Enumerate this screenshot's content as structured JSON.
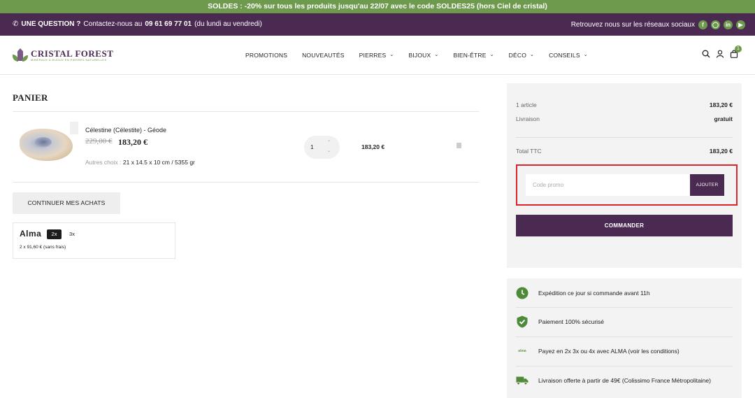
{
  "promo_bar": {
    "text": "SOLDES : -20% sur tous les produits jusqu'au 22/07 avec le code SOLDES25 (hors Ciel de cristal)"
  },
  "contact_bar": {
    "question_label": "UNE QUESTION ?",
    "contact_text": "Contactez-nous au",
    "phone": "09 61 69 77 01",
    "hours": "(du lundi au vendredi)",
    "social_text": "Retrouvez nous sur les réseaux sociaux",
    "socials": [
      "facebook-icon",
      "instagram-icon",
      "linkedin-icon",
      "youtube-icon"
    ]
  },
  "header": {
    "logo_name": "CRISTAL FOREST",
    "logo_tagline": "MINÉRAUX & BIJOUX EN PIERRES NATURELLES",
    "nav": [
      {
        "label": "PROMOTIONS",
        "dropdown": false
      },
      {
        "label": "NOUVEAUTÉS",
        "dropdown": false
      },
      {
        "label": "PIERRES",
        "dropdown": true
      },
      {
        "label": "BIJOUX",
        "dropdown": true
      },
      {
        "label": "BIEN-ÊTRE",
        "dropdown": true
      },
      {
        "label": "DÉCO",
        "dropdown": true
      },
      {
        "label": "CONSEILS",
        "dropdown": true
      }
    ],
    "cart_count": "1"
  },
  "cart": {
    "title": "PANIER",
    "item": {
      "name": "Célestine (Célestite) - Géode",
      "old_price": "229,00 €",
      "price": "183,20 €",
      "variant_label": "Autres choix :",
      "variant_value": "21 x 14.5 x 10 cm / 5355 gr",
      "quantity": "1",
      "line_total": "183,20 €"
    },
    "continue_label": "CONTINUER MES ACHATS",
    "alma": {
      "logo": "Alma",
      "options": [
        "2x",
        "3x"
      ],
      "selected": "2x",
      "info": "2 x 91,60 € (sans frais)"
    }
  },
  "summary": {
    "articles_label": "1 article",
    "articles_value": "183,20 €",
    "shipping_label": "Livraison",
    "shipping_value": "gratuit",
    "total_label": "Total TTC",
    "total_value": "183,20 €",
    "promo_placeholder": "Code promo",
    "promo_button": "AJOUTER",
    "order_button": "COMMANDER"
  },
  "reassurance": [
    {
      "icon": "clock-icon",
      "text": "Expédition ce jour si commande avant 11h"
    },
    {
      "icon": "shield-check-icon",
      "text": "Paiement 100% sécurisé"
    },
    {
      "icon": "alma-icon",
      "icon_text": "alma",
      "text": "Payez en 2x 3x ou 4x avec ALMA (voir les conditions)"
    },
    {
      "icon": "truck-icon",
      "text": "Livraison offerte à partir de 49€ (Colissimo France Métropolitaine)"
    }
  ],
  "colors": {
    "brand_purple": "#4b2a52",
    "brand_green": "#6e9a4d",
    "highlight_red": "#e0242b"
  }
}
